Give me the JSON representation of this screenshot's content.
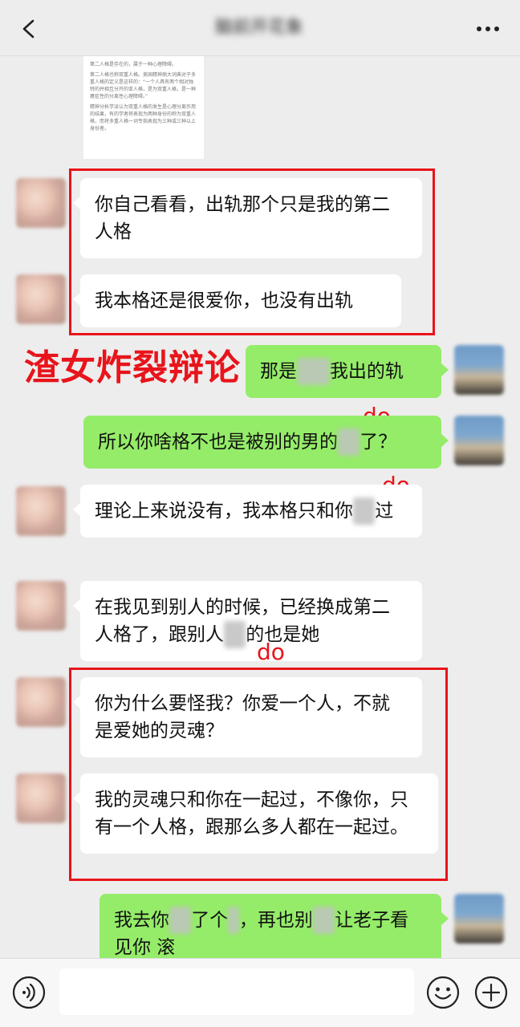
{
  "header": {
    "title": "脑前开花象",
    "back_icon": "chevron-left-icon",
    "more_icon": "more-dots-icon"
  },
  "shared_image": {
    "paragraphs": [
      "第二人格是存在的，属于一种心理障碍。",
      "第二人格也称双重人格。美国精神病大词典对于多重人格的定义是这样的：“一个人具有两个相对独特的并相互分开的亚人格，是为双重人格，是一种癔症性的分离性心理障碍。”",
      "精神分析学派认为双重人格的发生是心理分离作用的结果，有的学者将表现为两种身份的称为双重人格，而将多重人格一词专指表现为三种或三种以上身份者。"
    ]
  },
  "messages": [
    {
      "side": "left",
      "text": "你自己看看，出轨那个只是我的第二人格"
    },
    {
      "side": "left",
      "text": "我本格还是很爱你，也没有出轨"
    },
    {
      "side": "right",
      "parts": [
        "那是",
        "",
        "我出的轨"
      ]
    },
    {
      "side": "right",
      "parts": [
        "所以你啥格不也是被别的男的",
        "",
        "了？"
      ]
    },
    {
      "side": "left",
      "parts": [
        "理论上来说没有，我本格只和你",
        "",
        "过"
      ]
    },
    {
      "side": "left",
      "parts": [
        "在我见到别人的时候，已经换成第二人格了，跟别人",
        "",
        "的也是她"
      ]
    },
    {
      "side": "left",
      "text": "你为什么要怪我？你爱一个人，不就是爱她的灵魂？"
    },
    {
      "side": "left",
      "text": "我的灵魂只和你在一起过，不像你，只有一个人格，跟那么多人都在一起过。"
    },
    {
      "side": "right",
      "parts": [
        "我去你",
        "",
        "了个",
        "",
        "，再也别",
        "",
        "让老子看见你 滚"
      ]
    }
  ],
  "annotations": {
    "caption": "渣女炸裂辩论",
    "do_label": "do",
    "color": "#e8141b"
  },
  "input_bar": {
    "voice_icon": "voice-icon",
    "emoji_icon": "emoji-icon",
    "plus_icon": "plus-icon"
  },
  "colors": {
    "background": "#ededed",
    "bubble_self": "#95ec69",
    "bubble_other": "#ffffff"
  }
}
